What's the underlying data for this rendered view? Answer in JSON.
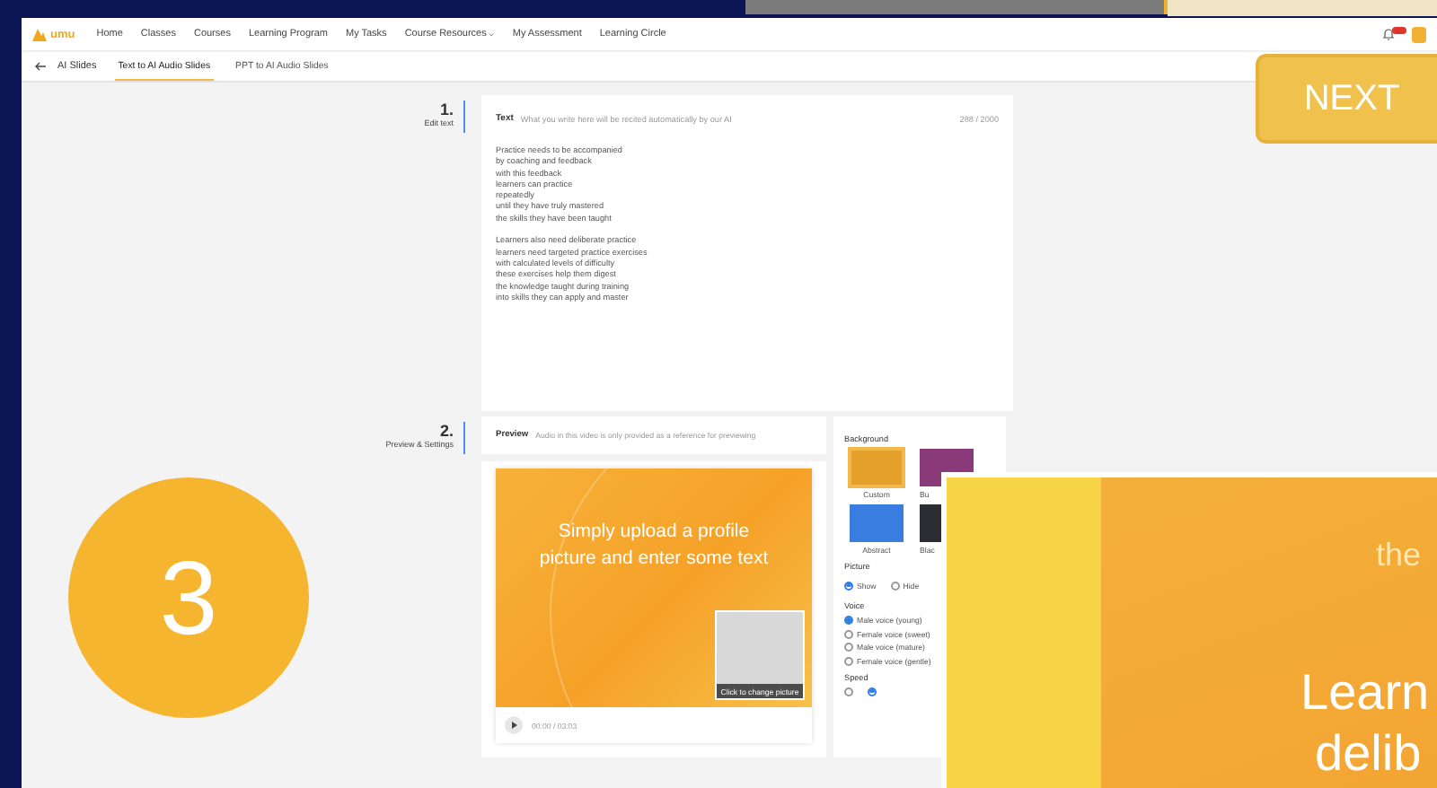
{
  "nav": {
    "logo": "umu",
    "items": [
      {
        "label": "Home",
        "kind": "link"
      },
      {
        "label": "Classes",
        "kind": "link"
      },
      {
        "label": "Courses",
        "kind": "link"
      },
      {
        "label": "Learning Program",
        "kind": "link"
      },
      {
        "label": "My Tasks",
        "kind": "link"
      },
      {
        "label": "Course Resources",
        "kind": "menu"
      },
      {
        "label": "My Assessment",
        "kind": "link"
      },
      {
        "label": "Learning Circle",
        "kind": "link"
      }
    ]
  },
  "subnav": {
    "back": "AI Slides",
    "tabs": [
      {
        "label": "Text to AI Audio Slides",
        "selected": true
      },
      {
        "label": "PPT to AI Audio Slides",
        "selected": false
      }
    ]
  },
  "steps": [
    {
      "number": "1.",
      "label": "Edit text"
    },
    {
      "number": "2.",
      "label": "Preview & Settings"
    }
  ],
  "text_editor": {
    "title": "Text",
    "hint": "What you write here will be recited automatically by our AI",
    "counter": "288 / 2000",
    "paragraphs": [
      [
        "Practice needs to be accompanied",
        "by coaching and feedback",
        "with this feedback",
        "learners can practice",
        "repeatedly",
        "until they have truly mastered",
        "the skills they have been taught"
      ],
      [
        "Learners also need deliberate practice",
        "learners need targeted practice exercises",
        "with calculated levels of difficulty",
        "these exercises help them digest",
        "the knowledge taught during training",
        "into skills they can apply and master"
      ]
    ]
  },
  "preview": {
    "title": "Preview",
    "hint": "Audio in this video is only provided as a reference for previewing",
    "slide_text": "Simply upload a profile picture and enter some text",
    "picture_caption": "Click to change picture",
    "time": "00:00 / 03:03"
  },
  "settings": {
    "background": {
      "title": "Background",
      "options": [
        {
          "label": "Custom",
          "selected": true,
          "color": "#e3a12c"
        },
        {
          "label": "Bu",
          "selected": false,
          "color": "#8a3a78"
        },
        {
          "label": "Abstract",
          "selected": false,
          "color": "#3a7de0"
        },
        {
          "label": "Blac",
          "selected": false,
          "color": "#2a2e33"
        }
      ]
    },
    "picture": {
      "title": "Picture",
      "options": [
        {
          "label": "Show",
          "selected": true
        },
        {
          "label": "Hide",
          "selected": false
        }
      ]
    },
    "voice": {
      "title": "Voice",
      "options": [
        {
          "label": "Male voice (young)",
          "selected": true
        },
        {
          "label": "Female voice (sweet)",
          "selected": false
        },
        {
          "label": "Male voice (mature)",
          "selected": false
        },
        {
          "label": "Female voice (gentle)",
          "selected": false
        }
      ]
    },
    "speed": {
      "title": "Speed",
      "options": [
        {
          "selected": false
        },
        {
          "selected": true
        }
      ]
    }
  },
  "overlays": {
    "next_button": "NEXT",
    "step_badge": "3",
    "slide_texts": [
      "the",
      "Learn",
      "delib"
    ]
  }
}
